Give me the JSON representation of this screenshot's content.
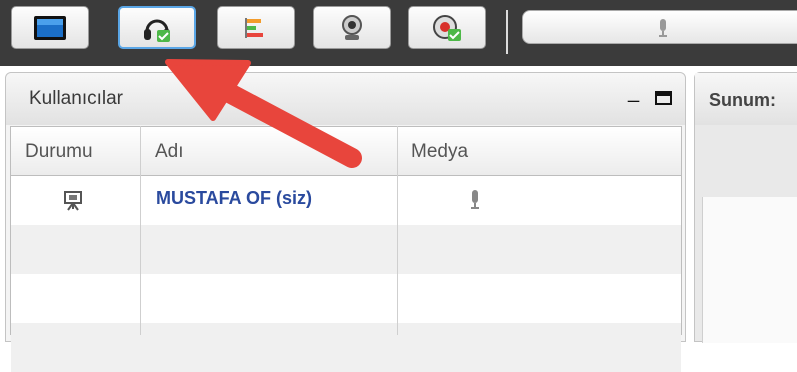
{
  "toolbar": {
    "buttons": [
      {
        "icon": "desktop-share-icon",
        "active": false
      },
      {
        "icon": "headset-icon",
        "active": true
      },
      {
        "icon": "poll-icon",
        "active": false
      },
      {
        "icon": "webcam-icon",
        "active": false
      },
      {
        "icon": "record-icon",
        "active": false
      }
    ],
    "audio_icon": "microphone-icon"
  },
  "users_panel": {
    "title": "Kullanıcılar",
    "minimize_label": "_",
    "columns": [
      "Durumu",
      "Adı",
      "Medya"
    ],
    "rows": [
      {
        "status_icon": "presenter-icon",
        "name": "MUSTAFA OF (siz)",
        "media_icon": "microphone-icon"
      },
      {
        "status_icon": "",
        "name": "",
        "media_icon": ""
      },
      {
        "status_icon": "",
        "name": "",
        "media_icon": ""
      },
      {
        "status_icon": "",
        "name": "",
        "media_icon": ""
      }
    ]
  },
  "presentation_panel": {
    "title": "Sunum:"
  },
  "annotation": {
    "arrow_color": "#e8453c"
  },
  "colors": {
    "toolbar_bg": "#3b3b3b",
    "active_border": "#5aa6e6",
    "user_name": "#2a4a9e"
  }
}
